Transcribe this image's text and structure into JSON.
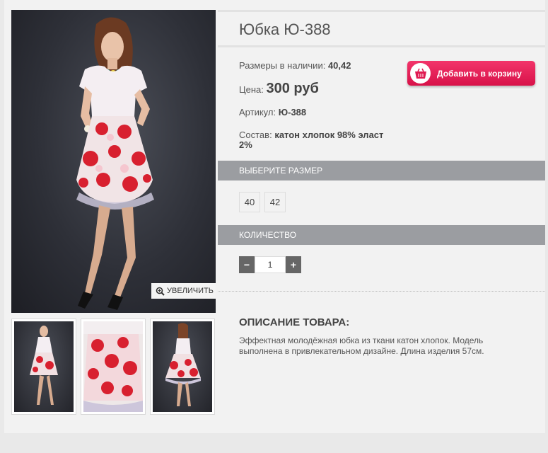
{
  "product": {
    "title": "Юбка Ю-388",
    "sizes_label": "Размеры в наличии:",
    "sizes_value": "40,42",
    "price_label": "Цена:",
    "price_value": "300 руб",
    "sku_label": "Артикул:",
    "sku_value": "Ю-388",
    "composition_label": "Состав:",
    "composition_value": "катон хлопок 98% эласт 2%"
  },
  "cart_button": {
    "label": "Добавить в корзину",
    "icon": "basket-icon"
  },
  "gallery": {
    "zoom_label": "УВЕЛИЧИТЬ",
    "zoom_icon": "magnifier-icon"
  },
  "size_section": {
    "header": "ВЫБЕРИТЕ РАЗМЕР",
    "options": [
      "40",
      "42"
    ]
  },
  "quantity_section": {
    "header": "КОЛИЧЕСТВО",
    "minus": "−",
    "plus": "+",
    "value": "1"
  },
  "description": {
    "title": "ОПИСАНИЕ ТОВАРА:",
    "text": "Эффектная молодёжная юбка из ткани катон хлопок. Модель выполнена в привлекательном дизайне. Длина изделия 57см."
  },
  "colors": {
    "accent": "#e01b52",
    "section_bar": "#9b9da1",
    "qty_button": "#666666"
  }
}
